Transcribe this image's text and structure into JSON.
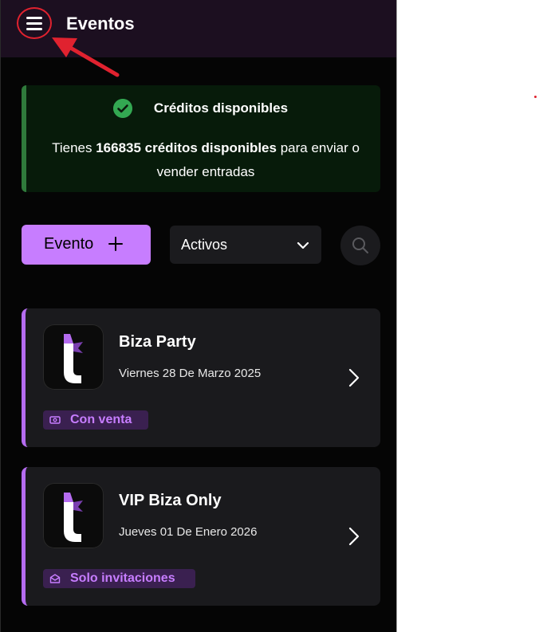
{
  "header": {
    "title": "Eventos",
    "menu_icon": "hamburger-menu-icon",
    "highlight_color": "#e0222f"
  },
  "credits": {
    "title": "Créditos disponibles",
    "body_prefix": "Tienes ",
    "body_bold": "166835 créditos disponibles",
    "body_suffix": " para enviar o vender entradas",
    "icon": "check-circle-icon",
    "accent": "#2f7a3b"
  },
  "toolbar": {
    "new_event_label": "Evento",
    "new_event_icon": "plus-icon",
    "filter_selected": "Activos",
    "filter_icon": "chevron-down-icon",
    "search_icon": "search-icon",
    "accent": "#c77dff"
  },
  "events": [
    {
      "name": "Biza Party",
      "date": "Viernes 28 De Marzo 2025",
      "badge": "Con venta",
      "badge_icon": "ticket-icon"
    },
    {
      "name": "VIP Biza Only",
      "date": "Jueves 01 De Enero 2026",
      "badge": "Solo invitaciones",
      "badge_icon": "envelope-icon"
    }
  ]
}
